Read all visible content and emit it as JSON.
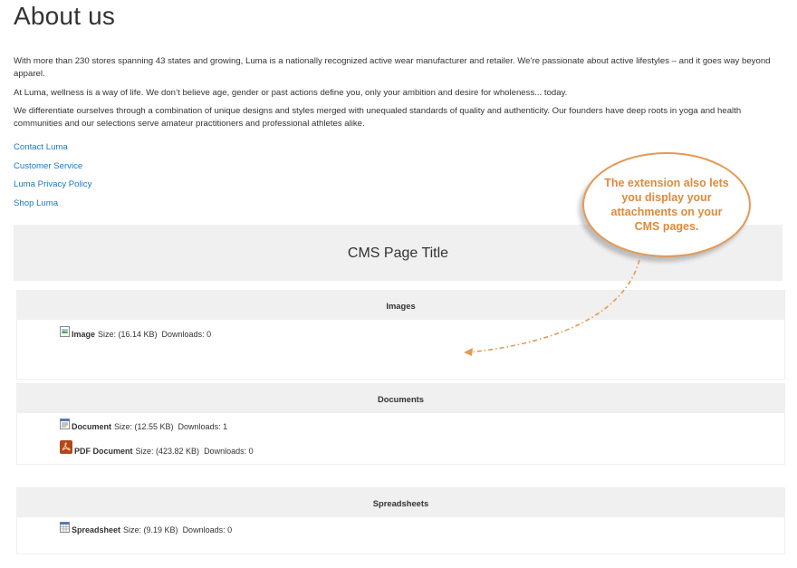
{
  "page": {
    "title": "About us",
    "paragraphs": [
      "With more than 230 stores spanning 43 states and growing, Luma is a nationally recognized active wear manufacturer and retailer. We’re passionate about active lifestyles – and it goes way beyond apparel.",
      "At Luma, wellness is a way of life. We don’t believe age, gender or past actions define you, only your ambition and desire for wholeness... today.",
      "We differentiate ourselves through a combination of unique designs and styles merged with unequaled standards of quality and authenticity. Our founders have deep roots in yoga and health communities and our selections serve amateur practitioners and professional athletes alike."
    ],
    "links": [
      "Contact Luma",
      "Customer Service",
      "Luma Privacy Policy",
      "Shop Luma"
    ]
  },
  "cms": {
    "title": "CMS Page Title",
    "sections": [
      {
        "header": "Images",
        "files": [
          {
            "name": "Image",
            "size": "Size: (16.14 KB)",
            "downloads": "Downloads: 0",
            "icon": "image-file-icon"
          }
        ]
      },
      {
        "header": "Documents",
        "files": [
          {
            "name": "Document",
            "size": "Size: (12.55 KB)",
            "downloads": "Downloads: 1",
            "icon": "document-file-icon"
          },
          {
            "name": "PDF Document",
            "size": "Size: (423.82 KB)",
            "downloads": "Downloads: 0",
            "icon": "pdf-file-icon"
          }
        ]
      },
      {
        "header": "Spreadsheets",
        "files": [
          {
            "name": "Spreadsheet",
            "size": "Size: (9.19 KB)",
            "downloads": "Downloads: 0",
            "icon": "spreadsheet-file-icon"
          }
        ]
      }
    ]
  },
  "callout": {
    "text": "The extension also lets you display your attachments on your CMS pages."
  },
  "colors": {
    "link": "#1979c3",
    "accent": "#e08a3a",
    "header_bg": "#f0f0f0"
  }
}
